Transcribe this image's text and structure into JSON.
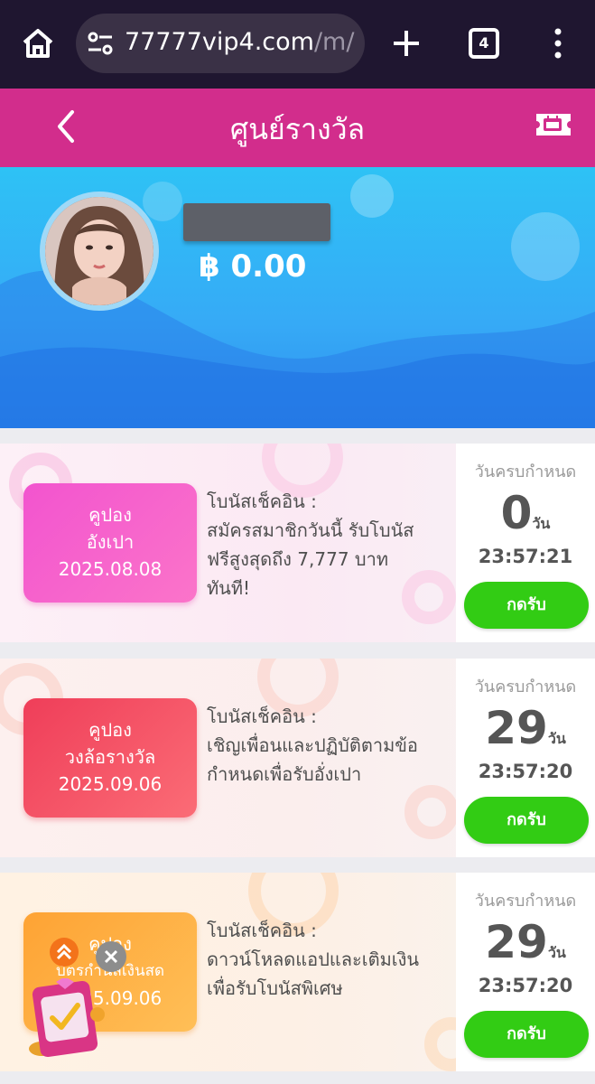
{
  "browser": {
    "url_main": "77777vip4.com",
    "url_rest": "/m/rec",
    "tab_count": "4"
  },
  "header": {
    "title": "ศูนย์รางวัล"
  },
  "profile": {
    "balance": "฿ 0.00"
  },
  "deadline_label": "วันครบกำหนด",
  "day_unit": "วัน",
  "claim_label": "กดรับ",
  "coupons": [
    {
      "line1": "คูปอง",
      "line2": "อังเปา",
      "date": "2025.08.08",
      "desc_title": "โบนัสเช็คอิน :",
      "desc_lines": [
        "สมัครสมาชิกวันนี้ รับโบนัส",
        "ฟรีสูงสุดถึง 7,777 บาท",
        "ทันที!"
      ],
      "days": "0",
      "time": "23:57:21",
      "color": "#f254cf"
    },
    {
      "line1": "คูปอง",
      "line2": "วงล้อรางวัล",
      "date": "2025.09.06",
      "desc_title": "โบนัสเช็คอิน :",
      "desc_lines": [
        "เชิญเพื่อนและปฏิบัติตามข้อ",
        "กำหนดเพื่อรับอั่งเปา"
      ],
      "days": "29",
      "time": "23:57:20",
      "color": "#ef3e59"
    },
    {
      "line1": "คูปอง",
      "line2": "บัตรกำนัลเงินสด",
      "date": "2025.09.06",
      "desc_title": "โบนัสเช็คอิน :",
      "desc_lines": [
        "ดาวน์โหลดแอปและเติมเงิน",
        "เพื่อรับโบนัสพิเศษ"
      ],
      "days": "29",
      "time": "23:57:20",
      "color": "#fea334"
    }
  ],
  "colors": {
    "browser_bg": "#1f1630",
    "header_bg": "#d22d8c",
    "hero_bg": "#2ec2f5",
    "claim_button": "#32cc14"
  },
  "icons": [
    "home-icon",
    "site-settings-icon",
    "plus-icon",
    "tabs-icon",
    "more-vert-icon",
    "back-icon",
    "ticket-icon",
    "chevron-up-icon",
    "close-icon"
  ]
}
